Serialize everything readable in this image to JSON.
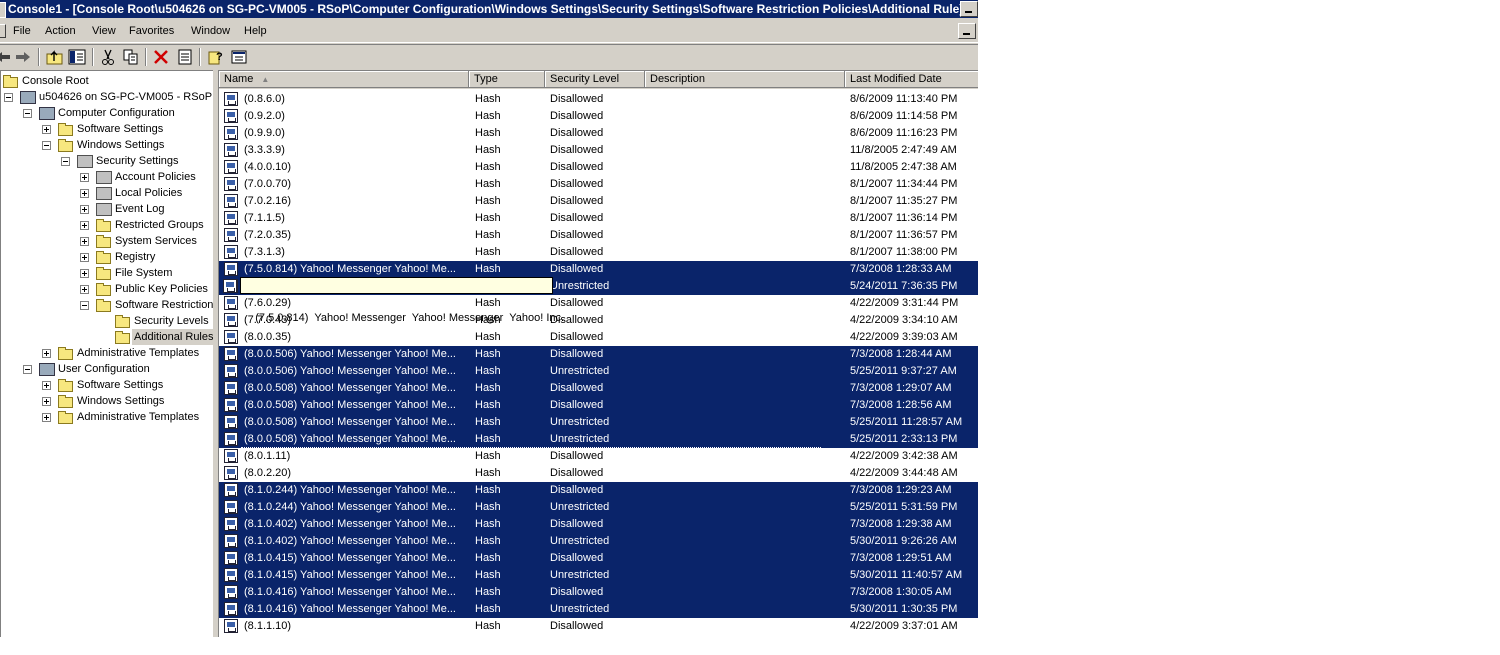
{
  "window": {
    "title": "Console1 - [Console Root\\u504626 on SG-PC-VM005 - RSoP\\Computer Configuration\\Windows Settings\\Security Settings\\Software Restriction Policies\\Additional Rule]"
  },
  "menu": [
    "File",
    "Action",
    "View",
    "Favorites",
    "Window",
    "Help"
  ],
  "tree": [
    {
      "label": "Console Root",
      "level": 0,
      "icon": "folder-icon",
      "expander": "none"
    },
    {
      "label": "u504626 on SG-PC-VM005 - RSoP",
      "level": 1,
      "icon": "rsop-computer-icon",
      "expander": "minus"
    },
    {
      "label": "Computer Configuration",
      "level": 2,
      "icon": "computer-icon",
      "expander": "minus"
    },
    {
      "label": "Software Settings",
      "level": 3,
      "icon": "folder-icon",
      "expander": "plus"
    },
    {
      "label": "Windows Settings",
      "level": 3,
      "icon": "folder-icon",
      "expander": "minus"
    },
    {
      "label": "Security Settings",
      "level": 4,
      "icon": "security-icon",
      "expander": "minus"
    },
    {
      "label": "Account Policies",
      "level": 5,
      "icon": "policy-icon",
      "expander": "plus"
    },
    {
      "label": "Local Policies",
      "level": 5,
      "icon": "policy-icon",
      "expander": "plus"
    },
    {
      "label": "Event Log",
      "level": 5,
      "icon": "policy-icon",
      "expander": "plus"
    },
    {
      "label": "Restricted Groups",
      "level": 5,
      "icon": "locked-folder-icon",
      "expander": "plus"
    },
    {
      "label": "System Services",
      "level": 5,
      "icon": "locked-folder-icon",
      "expander": "plus"
    },
    {
      "label": "Registry",
      "level": 5,
      "icon": "locked-folder-icon",
      "expander": "plus"
    },
    {
      "label": "File System",
      "level": 5,
      "icon": "locked-folder-icon",
      "expander": "plus"
    },
    {
      "label": "Public Key Policies",
      "level": 5,
      "icon": "folder-icon",
      "expander": "plus"
    },
    {
      "label": "Software Restriction P",
      "level": 5,
      "icon": "folder-icon",
      "expander": "minus"
    },
    {
      "label": "Security Levels",
      "level": 6,
      "icon": "folder-icon",
      "expander": "none"
    },
    {
      "label": "Additional Rules",
      "level": 6,
      "icon": "open-folder-icon",
      "expander": "none",
      "selected": true
    },
    {
      "label": "Administrative Templates",
      "level": 3,
      "icon": "folder-icon",
      "expander": "plus"
    },
    {
      "label": "User Configuration",
      "level": 2,
      "icon": "user-icon",
      "expander": "minus"
    },
    {
      "label": "Software Settings",
      "level": 3,
      "icon": "folder-icon",
      "expander": "plus"
    },
    {
      "label": "Windows Settings",
      "level": 3,
      "icon": "folder-icon",
      "expander": "plus"
    },
    {
      "label": "Administrative Templates",
      "level": 3,
      "icon": "folder-icon",
      "expander": "plus"
    }
  ],
  "columns": [
    "Name",
    "Type",
    "Security Level",
    "Description",
    "Last Modified Date"
  ],
  "rows": [
    {
      "name": "(0.8.6.0)",
      "type": "Hash",
      "level": "Disallowed",
      "date": "8/6/2009  11:13:40 PM",
      "selected": false
    },
    {
      "name": "(0.9.2.0)",
      "type": "Hash",
      "level": "Disallowed",
      "date": "8/6/2009  11:14:58 PM",
      "selected": false
    },
    {
      "name": "(0.9.9.0)",
      "type": "Hash",
      "level": "Disallowed",
      "date": "8/6/2009  11:16:23 PM",
      "selected": false
    },
    {
      "name": "(3.3.3.9)",
      "type": "Hash",
      "level": "Disallowed",
      "date": "11/8/2005  2:47:49 AM",
      "selected": false
    },
    {
      "name": "(4.0.0.10)",
      "type": "Hash",
      "level": "Disallowed",
      "date": "11/8/2005  2:47:38 AM",
      "selected": false
    },
    {
      "name": "(7.0.0.70)",
      "type": "Hash",
      "level": "Disallowed",
      "date": "8/1/2007  11:34:44 PM",
      "selected": false
    },
    {
      "name": "(7.0.2.16)",
      "type": "Hash",
      "level": "Disallowed",
      "date": "8/1/2007  11:35:27 PM",
      "selected": false
    },
    {
      "name": "(7.1.1.5)",
      "type": "Hash",
      "level": "Disallowed",
      "date": "8/1/2007  11:36:14 PM",
      "selected": false
    },
    {
      "name": "(7.2.0.35)",
      "type": "Hash",
      "level": "Disallowed",
      "date": "8/1/2007  11:36:57 PM",
      "selected": false
    },
    {
      "name": "(7.3.1.3)",
      "type": "Hash",
      "level": "Disallowed",
      "date": "8/1/2007  11:38:00 PM",
      "selected": false
    },
    {
      "name": "(7.5.0.814)  Yahoo! Messenger  Yahoo! Me...",
      "type": "Hash",
      "level": "Disallowed",
      "date": "7/3/2008  1:28:33 AM",
      "selected": true
    },
    {
      "name": "(7.5.0.814)  Yahoo! Messenger  Yahoo! Me...",
      "type": "Hash",
      "level": "Unrestricted",
      "date": "5/24/2011  7:36:35 PM",
      "selected": true
    },
    {
      "name": "(7.6.0.29)",
      "type": "Hash",
      "level": "Disallowed",
      "date": "4/22/2009  3:31:44 PM",
      "selected": false
    },
    {
      "name": "(7.7.0.43)",
      "type": "Hash",
      "level": "Disallowed",
      "date": "4/22/2009  3:34:10 AM",
      "selected": false
    },
    {
      "name": "(8.0.0.35)",
      "type": "Hash",
      "level": "Disallowed",
      "date": "4/22/2009  3:39:03 AM",
      "selected": false
    },
    {
      "name": "(8.0.0.506)  Yahoo! Messenger  Yahoo! Me...",
      "type": "Hash",
      "level": "Disallowed",
      "date": "7/3/2008  1:28:44 AM",
      "selected": true
    },
    {
      "name": "(8.0.0.506)  Yahoo! Messenger  Yahoo! Me...",
      "type": "Hash",
      "level": "Unrestricted",
      "date": "5/25/2011  9:37:27 AM",
      "selected": true
    },
    {
      "name": "(8.0.0.508)  Yahoo! Messenger  Yahoo! Me...",
      "type": "Hash",
      "level": "Disallowed",
      "date": "7/3/2008  1:29:07 AM",
      "selected": true
    },
    {
      "name": "(8.0.0.508)  Yahoo! Messenger  Yahoo! Me...",
      "type": "Hash",
      "level": "Disallowed",
      "date": "7/3/2008  1:28:56 AM",
      "selected": true
    },
    {
      "name": "(8.0.0.508)  Yahoo! Messenger  Yahoo! Me...",
      "type": "Hash",
      "level": "Unrestricted",
      "date": "5/25/2011  11:28:57 AM",
      "selected": true
    },
    {
      "name": "(8.0.0.508)  Yahoo! Messenger  Yahoo! Me...",
      "type": "Hash",
      "level": "Unrestricted",
      "date": "5/25/2011  2:33:13 PM",
      "selected": true
    },
    {
      "name": "(8.0.1.11)",
      "type": "Hash",
      "level": "Disallowed",
      "date": "4/22/2009  3:42:38 AM",
      "selected": false
    },
    {
      "name": "(8.0.2.20)",
      "type": "Hash",
      "level": "Disallowed",
      "date": "4/22/2009  3:44:48 AM",
      "selected": false
    },
    {
      "name": "(8.1.0.244)  Yahoo! Messenger  Yahoo! Me...",
      "type": "Hash",
      "level": "Disallowed",
      "date": "7/3/2008  1:29:23 AM",
      "selected": true
    },
    {
      "name": "(8.1.0.244)  Yahoo! Messenger  Yahoo! Me...",
      "type": "Hash",
      "level": "Unrestricted",
      "date": "5/25/2011  5:31:59 PM",
      "selected": true
    },
    {
      "name": "(8.1.0.402)  Yahoo! Messenger  Yahoo! Me...",
      "type": "Hash",
      "level": "Disallowed",
      "date": "7/3/2008  1:29:38 AM",
      "selected": true
    },
    {
      "name": "(8.1.0.402)  Yahoo! Messenger  Yahoo! Me...",
      "type": "Hash",
      "level": "Unrestricted",
      "date": "5/30/2011  9:26:26 AM",
      "selected": true
    },
    {
      "name": "(8.1.0.415)  Yahoo! Messenger  Yahoo! Me...",
      "type": "Hash",
      "level": "Disallowed",
      "date": "7/3/2008  1:29:51 AM",
      "selected": true
    },
    {
      "name": "(8.1.0.415)  Yahoo! Messenger  Yahoo! Me...",
      "type": "Hash",
      "level": "Unrestricted",
      "date": "5/30/2011  11:40:57 AM",
      "selected": true
    },
    {
      "name": "(8.1.0.416)  Yahoo! Messenger  Yahoo! Me...",
      "type": "Hash",
      "level": "Disallowed",
      "date": "7/3/2008  1:30:05 AM",
      "selected": true
    },
    {
      "name": "(8.1.0.416)  Yahoo! Messenger  Yahoo! Me...",
      "type": "Hash",
      "level": "Unrestricted",
      "date": "5/30/2011  1:30:35 PM",
      "selected": true
    },
    {
      "name": "(8.1.1.10)",
      "type": "Hash",
      "level": "Disallowed",
      "date": "4/22/2009  3:37:01 AM",
      "selected": false
    }
  ],
  "tooltip": "(7.5.0.814)  Yahoo! Messenger  Yahoo! Messenger  Yahoo! Inc.",
  "colors": {
    "selection": "#0a246a",
    "face": "#d4d0c8",
    "tooltip": "#ffffe1"
  }
}
